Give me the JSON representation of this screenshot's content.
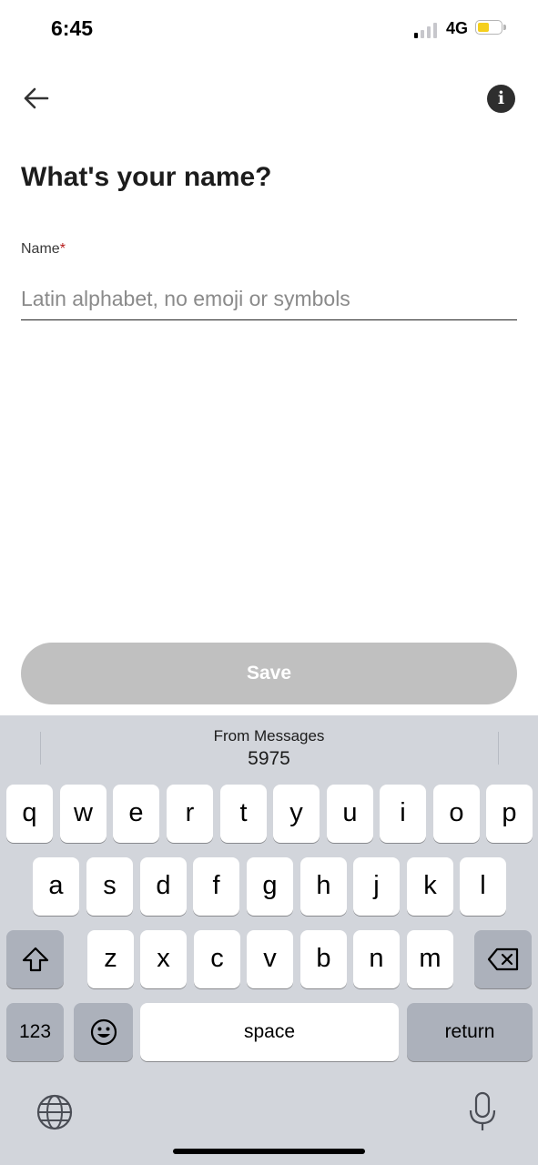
{
  "status_bar": {
    "time": "6:45",
    "network": "4G",
    "battery_color": "#f5cf1d"
  },
  "header": {
    "back_icon": "arrow-left-icon",
    "info_icon": "info-icon"
  },
  "page": {
    "title": "What's your name?",
    "name_label": "Name",
    "required_marker": "*",
    "name_placeholder": "Latin alphabet, no emoji or symbols",
    "name_value": ""
  },
  "save_button": {
    "label": "Save",
    "background": "#c0c0c0"
  },
  "keyboard": {
    "suggestion_source": "From Messages",
    "suggestion_value": "5975",
    "row1": [
      "q",
      "w",
      "e",
      "r",
      "t",
      "y",
      "u",
      "i",
      "o",
      "p"
    ],
    "row2": [
      "a",
      "s",
      "d",
      "f",
      "g",
      "h",
      "j",
      "k",
      "l"
    ],
    "row3": [
      "z",
      "x",
      "c",
      "v",
      "b",
      "n",
      "m"
    ],
    "numbers_label": "123",
    "space_label": "space",
    "return_label": "return"
  }
}
